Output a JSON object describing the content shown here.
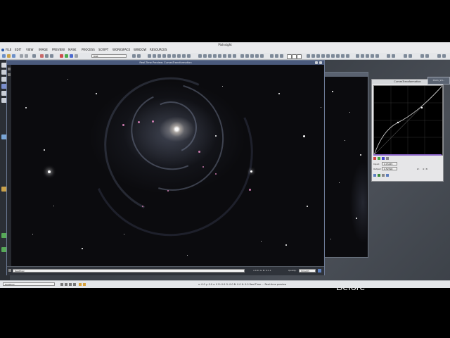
{
  "app": {
    "title": "PixInsight",
    "menus": [
      "FILE",
      "EDIT",
      "VIEW",
      "IMAGE",
      "PREVIEW",
      "MASK",
      "PROCESS",
      "SCRIPT",
      "WORKSPACE",
      "WINDOW",
      "RESOURCES"
    ],
    "toolbar_select": "RGB"
  },
  "preview_window": {
    "title": "Real-Time Preview: CurvesTransformation",
    "view_name": "RealPixel",
    "readout": "x:4 R: G: B: K:1.1",
    "quality_label": "Quality:",
    "quality_value": "Smooth"
  },
  "thumbnail": {
    "label": "M101_SH..."
  },
  "curves_window": {
    "title": "CurvesTransformation",
    "input_label": "Input:",
    "input_value": "0.15645",
    "output_label": "Output:",
    "output_value": "0.52590",
    "point_label": "#:",
    "point_value": "4 / 8"
  },
  "overlay": {
    "before_label": "Before"
  },
  "status_bar": {
    "view_field": "RealPixel",
    "coords": "x: 0.0 y: 0.0 z: 0 R: 0.0 G: 0.0 B: 0.0 K: 0.0 Real-Time ... Real-time preview",
    "mode": "ReadyTool - Real-time preview"
  },
  "colors": {
    "title_accent": "#4a5a7c",
    "rgb_bar": "#8a63c7",
    "curve": "#d8d8d8"
  }
}
